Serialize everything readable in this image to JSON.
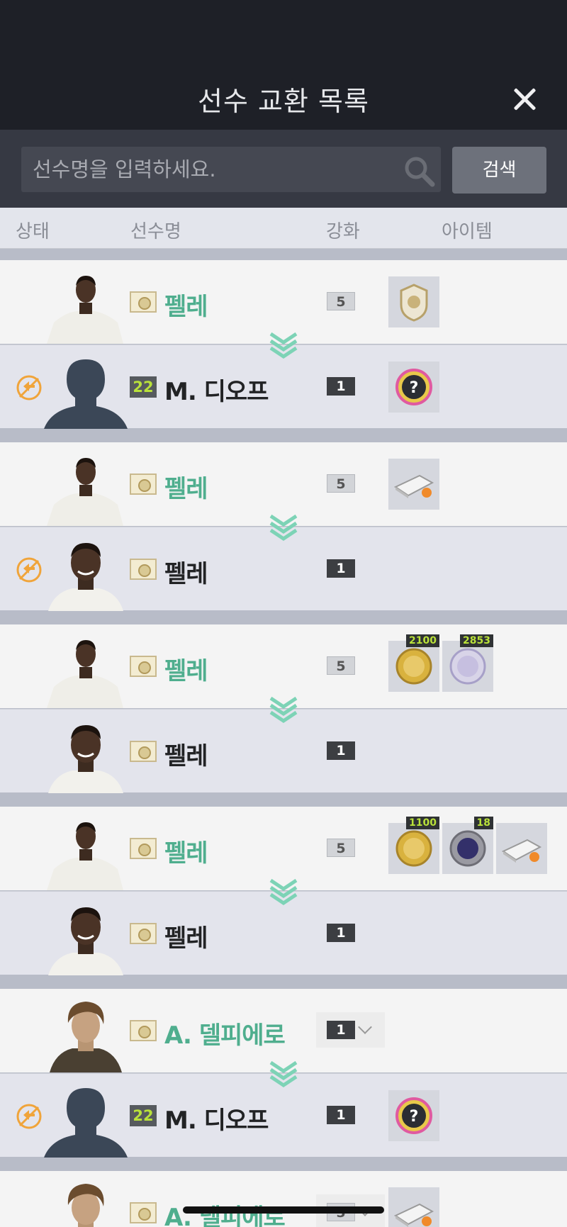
{
  "header": {
    "title": "선수 교환 목록"
  },
  "search": {
    "placeholder": "선수명을 입력하세요.",
    "button_label": "검색"
  },
  "columns": {
    "status": "상태",
    "player": "선수명",
    "grade": "강화",
    "item": "아이템"
  },
  "colors": {
    "accent_green": "#4fae8e",
    "status_orange": "#f0a43a",
    "header_bg": "#1e2027"
  },
  "groups": [
    {
      "from": {
        "name": "펠레",
        "grade": "5",
        "items": [
          {
            "icon": "icon-badge-item",
            "count": ""
          }
        ]
      },
      "to": {
        "badge": "22",
        "name": "M. 디오프",
        "grade": "1",
        "status": "swap-icon",
        "items": [
          {
            "icon": "mystery-pack-item",
            "count": ""
          }
        ]
      }
    },
    {
      "from": {
        "name": "펠레",
        "grade": "5",
        "items": [
          {
            "icon": "boost-card-item",
            "count": ""
          }
        ]
      },
      "to": {
        "name": "펠레",
        "grade": "1",
        "status": "swap-icon",
        "items": []
      }
    },
    {
      "from": {
        "name": "펠레",
        "grade": "5",
        "items": [
          {
            "icon": "gold-coin-item",
            "count": "2100"
          },
          {
            "icon": "silver-coin-item",
            "count": "2853"
          }
        ]
      },
      "to": {
        "name": "펠레",
        "grade": "1",
        "status": "",
        "items": []
      }
    },
    {
      "from": {
        "name": "펠레",
        "grade": "5",
        "items": [
          {
            "icon": "gold-coin-item",
            "count": "1100"
          },
          {
            "icon": "dark-coin-item",
            "count": "18"
          },
          {
            "icon": "boost-card-item",
            "count": ""
          }
        ]
      },
      "to": {
        "name": "펠레",
        "grade": "1",
        "status": "",
        "items": []
      }
    },
    {
      "from": {
        "name": "A. 델피에로",
        "grade": "1",
        "items": []
      },
      "to": {
        "badge": "22",
        "name": "M. 디오프",
        "grade": "1",
        "status": "swap-icon",
        "items": [
          {
            "icon": "mystery-pack-item",
            "count": ""
          }
        ]
      }
    },
    {
      "from": {
        "name": "A. 델피에로",
        "grade": "5",
        "items": [
          {
            "icon": "boost-card-item",
            "count": ""
          }
        ]
      }
    }
  ]
}
